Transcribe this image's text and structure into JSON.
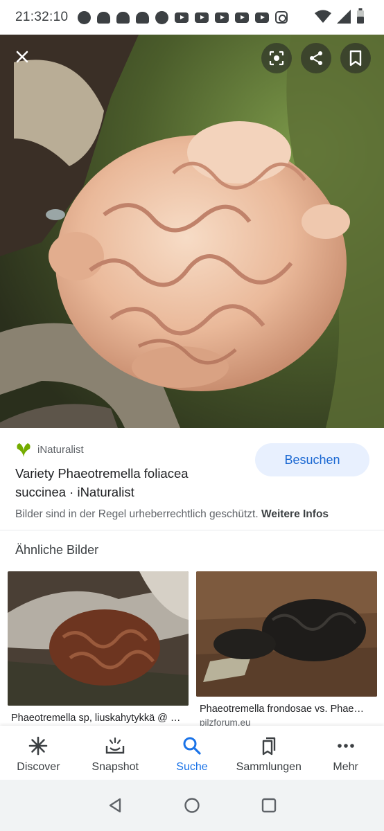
{
  "status_bar": {
    "time": "21:32:10",
    "icons": [
      "chat-icon",
      "discord-icon",
      "discord-icon",
      "discord-icon",
      "facebook-icon",
      "youtube-icon",
      "youtube-icon",
      "youtube-icon",
      "youtube-icon",
      "youtube-icon",
      "instagram-icon",
      "wifi-icon",
      "signal-icon",
      "battery-icon"
    ]
  },
  "viewer": {
    "close_icon": "close-icon",
    "actions": [
      "lens-icon",
      "share-icon",
      "bookmark-icon"
    ]
  },
  "source": {
    "site_name": "iNaturalist",
    "title": "Variety Phaeotremella foliacea succinea · iNaturalist",
    "visit_label": "Besuchen",
    "copyright_text": "Bilder sind in der Regel urheberrechtlich geschützt.",
    "more_info_label": "Weitere Infos"
  },
  "similar": {
    "heading": "Ähnliche Bilder",
    "items": [
      {
        "caption": "Phaeotremella sp, liuskahytykkä @ …",
        "source": ""
      },
      {
        "caption": "Phaeotremella frondosae vs. Phae…",
        "source": "pilzforum.eu"
      }
    ]
  },
  "bottom_nav": {
    "items": [
      {
        "label": "Discover",
        "icon": "asterisk-icon",
        "active": false
      },
      {
        "label": "Snapshot",
        "icon": "snapshot-icon",
        "active": false
      },
      {
        "label": "Suche",
        "icon": "search-icon",
        "active": true
      },
      {
        "label": "Sammlungen",
        "icon": "collections-icon",
        "active": false
      },
      {
        "label": "Mehr",
        "icon": "more-icon",
        "active": false
      }
    ]
  },
  "colors": {
    "accent": "#1a73e8",
    "visit_bg": "#e8f0fe",
    "inaturalist_green": "#74ac00"
  }
}
